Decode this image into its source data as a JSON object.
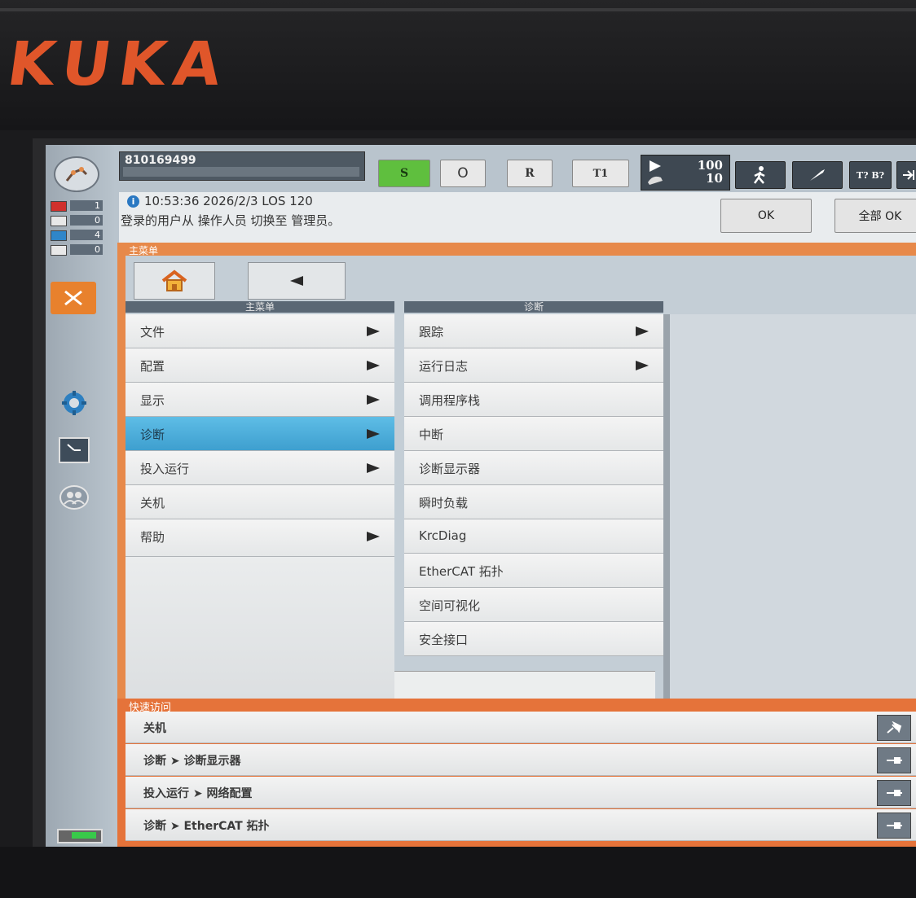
{
  "brand": {
    "logo": "KUKA"
  },
  "status": {
    "robot_name": "810169499",
    "submit": "S",
    "drives": "O",
    "robot_interpreter": "R",
    "mode": "T1",
    "override_program": "100",
    "override_jog": "10",
    "tool_base": "T? B?"
  },
  "message": {
    "info_icon": "i",
    "timestamp": "10:53:36 2026/2/3 LOS 120",
    "text": "登录的用户从 操作人员 切换至 管理员。",
    "ok_label": "OK",
    "all_ok_label": "全部 OK"
  },
  "message_counts": [
    {
      "icon": "error-icon",
      "color": "#d0312d",
      "count": "1"
    },
    {
      "icon": "warning-icon",
      "color": "#e8e8e8",
      "count": "0"
    },
    {
      "icon": "info-icon",
      "color": "#2f86c9",
      "count": "4"
    },
    {
      "icon": "dialog-icon",
      "color": "#e8e8e8",
      "count": "0"
    }
  ],
  "main_menu": {
    "panel_title": "主菜单",
    "column1_header": "主菜单",
    "column2_header": "诊断",
    "items": [
      {
        "label": "文件",
        "has_submenu": true
      },
      {
        "label": "配置",
        "has_submenu": true
      },
      {
        "label": "显示",
        "has_submenu": true
      },
      {
        "label": "诊断",
        "has_submenu": true,
        "selected": true
      },
      {
        "label": "投入运行",
        "has_submenu": true
      },
      {
        "label": "关机",
        "has_submenu": false
      },
      {
        "label": "帮助",
        "has_submenu": true
      }
    ],
    "sub_items": [
      {
        "label": "跟踪",
        "has_submenu": true
      },
      {
        "label": "运行日志",
        "has_submenu": true
      },
      {
        "label": "调用程序栈",
        "has_submenu": false
      },
      {
        "label": "中断",
        "has_submenu": false
      },
      {
        "label": "诊断显示器",
        "has_submenu": false
      },
      {
        "label": "瞬时负载",
        "has_submenu": false
      },
      {
        "label": "KrcDiag",
        "has_submenu": false
      },
      {
        "label": "EtherCAT 拓扑",
        "has_submenu": false
      },
      {
        "label": "空间可视化",
        "has_submenu": false
      },
      {
        "label": "安全接口",
        "has_submenu": false
      }
    ]
  },
  "quick_access": {
    "title": "快速访问",
    "items": [
      {
        "label": "关机",
        "pinned": false
      },
      {
        "label": "诊断 ➤ 诊断显示器",
        "pinned": true
      },
      {
        "label": "投入运行 ➤ 网络配置",
        "pinned": true
      },
      {
        "label": "诊断 ➤ EtherCAT 拓扑",
        "pinned": true
      }
    ]
  },
  "colors": {
    "accent_orange": "#e7894a",
    "selected_blue": "#4aaedb",
    "status_green": "#5fbf3e"
  }
}
